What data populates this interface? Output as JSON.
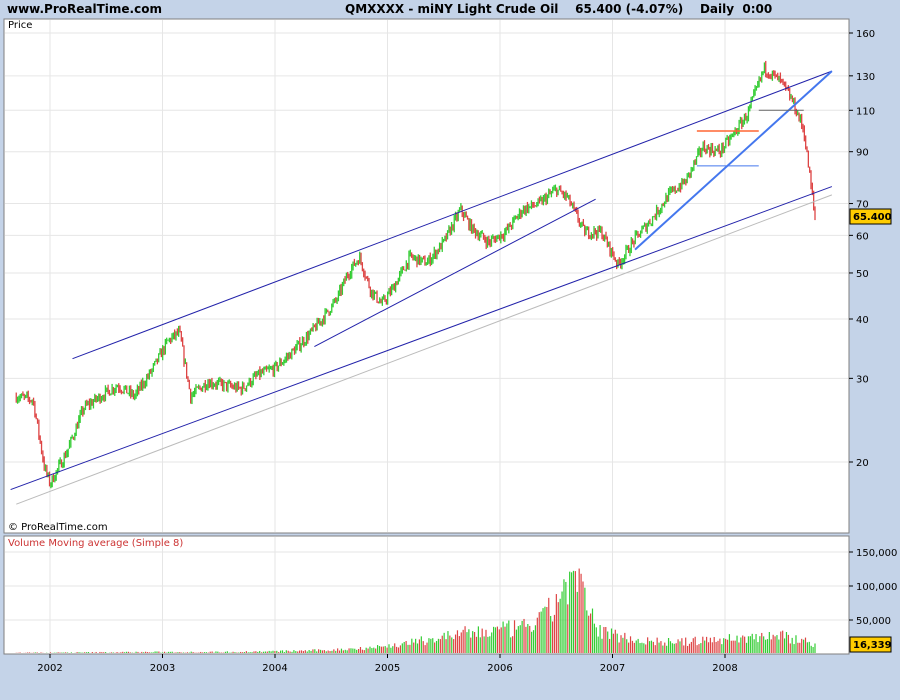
{
  "header": {
    "site": "www.ProRealTime.com",
    "symbol": "QMXXXX - miNY Light Crude Oil",
    "last": "65.400 (-4.07%)",
    "period": "Daily  0:00"
  },
  "price_panel": {
    "label": "Price",
    "watermark": "© ProRealTime.com",
    "last_value": "65.400"
  },
  "volume_panel": {
    "label": "Volume Moving average (Simple 8)",
    "last_value": "16,339"
  },
  "colors": {
    "up": "#33cc33",
    "down": "#dd4444",
    "trendline": "#2222aa",
    "trendline_light": "#4477ee",
    "marker_orange": "#ff6633",
    "badge": "#ffcc00",
    "panel_bg": "#ffffff",
    "frame_bg": "#c4d3e8"
  },
  "chart_data": [
    {
      "type": "line",
      "title": "QMXXXX - miNY Light Crude Oil",
      "ylabel": "Price",
      "yscale": "log",
      "ylim": [
        16,
        165
      ],
      "yticks": [
        20,
        30,
        40,
        50,
        60,
        70,
        90,
        110,
        130,
        160
      ],
      "xticks": [
        "2002",
        "2003",
        "2004",
        "2005",
        "2006",
        "2007",
        "2008"
      ],
      "series": [
        {
          "x": [
            2001.7,
            2001.85,
            2001.95,
            2002.0,
            2002.15,
            2002.3,
            2002.45,
            2002.6,
            2002.75,
            2002.9,
            2003.05,
            2003.15,
            2003.25,
            2003.4,
            2003.55,
            2003.7,
            2003.85,
            2004.0,
            2004.15,
            2004.3,
            2004.4,
            2004.55,
            2004.65,
            2004.75,
            2004.85,
            2004.95,
            2005.05,
            2005.2,
            2005.35,
            2005.5,
            2005.65,
            2005.75,
            2005.9,
            2006.05,
            2006.2,
            2006.35,
            2006.5,
            2006.6,
            2006.75,
            2006.9,
            2007.05,
            2007.2,
            2007.35,
            2007.5,
            2007.65,
            2007.8,
            2007.95,
            2008.05,
            2008.2,
            2008.35,
            2008.5,
            2008.6,
            2008.7,
            2008.8
          ],
          "values": [
            27.5,
            27.0,
            19.5,
            18.0,
            21.0,
            26.0,
            27.5,
            29.0,
            27.5,
            31.0,
            36.0,
            37.5,
            27.5,
            29.5,
            29.0,
            28.5,
            30.5,
            31.5,
            34.0,
            37.0,
            39.5,
            44.0,
            50.0,
            54.0,
            46.0,
            43.0,
            46.5,
            54.0,
            52.5,
            58.0,
            68.0,
            62.0,
            58.0,
            61.0,
            68.0,
            70.0,
            75.0,
            72.0,
            61.0,
            61.0,
            52.0,
            59.0,
            65.0,
            73.0,
            78.0,
            92.0,
            90.0,
            96.0,
            108.0,
            135.0,
            126.0,
            115.0,
            100.0,
            65.4
          ]
        }
      ]
    },
    {
      "type": "bar",
      "title": "Volume Moving average (Simple 8)",
      "ylim": [
        0,
        160000
      ],
      "yticks": [
        50000,
        100000,
        150000
      ],
      "ytick_labels": [
        "50,000",
        "100,000",
        "150,000"
      ],
      "series": [
        {
          "x": [
            2001.7,
            2002.0,
            2002.5,
            2003.0,
            2003.5,
            2004.0,
            2004.5,
            2005.0,
            2005.3,
            2005.6,
            2005.9,
            2006.2,
            2006.4,
            2006.55,
            2006.65,
            2006.75,
            2006.85,
            2007.0,
            2007.3,
            2007.6,
            2007.9,
            2008.2,
            2008.4,
            2008.6,
            2008.8
          ],
          "values": [
            2000,
            2000,
            2500,
            3000,
            3000,
            4000,
            6000,
            12000,
            20000,
            30000,
            35000,
            40000,
            55000,
            95000,
            120000,
            85000,
            40000,
            30000,
            20000,
            18000,
            22000,
            25000,
            30000,
            25000,
            16339
          ]
        }
      ]
    }
  ]
}
